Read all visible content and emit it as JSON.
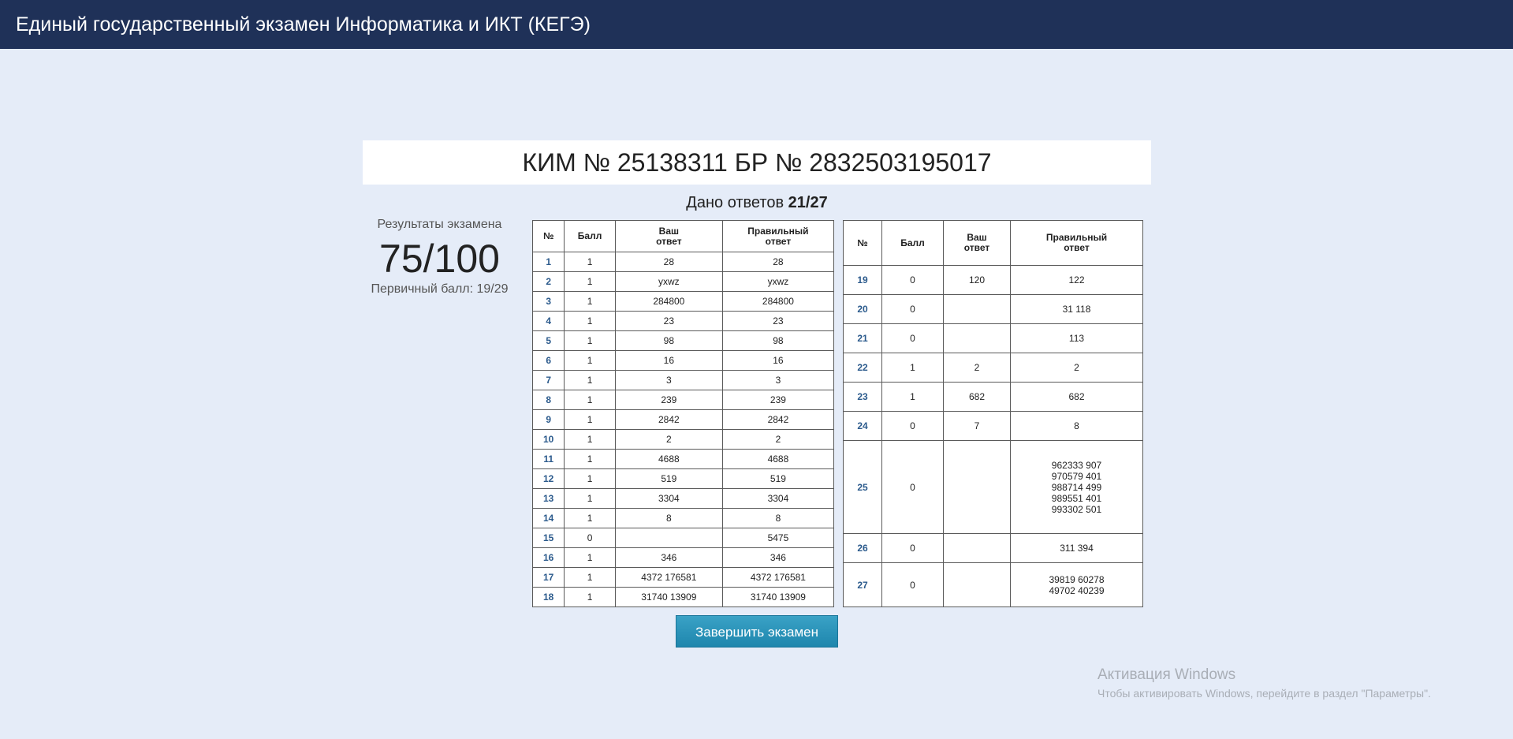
{
  "header": {
    "title": "Единый государственный экзамен Информатика и ИКТ (КЕГЭ)"
  },
  "kim_title": "КИМ № 25138311 БР № 2832503195017",
  "answered": {
    "label": "Дано ответов",
    "value": "21/27"
  },
  "results": {
    "label": "Результаты экзамена",
    "score": "75/100",
    "primary": "Первичный балл: 19/29"
  },
  "table_headers": {
    "num": "№",
    "score": "Балл",
    "your_answer": [
      "Ваш",
      "ответ"
    ],
    "correct_answer": [
      "Правильный",
      "ответ"
    ]
  },
  "left_rows": [
    {
      "num": "1",
      "score": "1",
      "yours": [
        "28"
      ],
      "correct": [
        "28"
      ]
    },
    {
      "num": "2",
      "score": "1",
      "yours": [
        "yxwz"
      ],
      "correct": [
        "yxwz"
      ]
    },
    {
      "num": "3",
      "score": "1",
      "yours": [
        "284800"
      ],
      "correct": [
        "284800"
      ]
    },
    {
      "num": "4",
      "score": "1",
      "yours": [
        "23"
      ],
      "correct": [
        "23"
      ]
    },
    {
      "num": "5",
      "score": "1",
      "yours": [
        "98"
      ],
      "correct": [
        "98"
      ]
    },
    {
      "num": "6",
      "score": "1",
      "yours": [
        "16"
      ],
      "correct": [
        "16"
      ]
    },
    {
      "num": "7",
      "score": "1",
      "yours": [
        "3"
      ],
      "correct": [
        "3"
      ]
    },
    {
      "num": "8",
      "score": "1",
      "yours": [
        "239"
      ],
      "correct": [
        "239"
      ]
    },
    {
      "num": "9",
      "score": "1",
      "yours": [
        "2842"
      ],
      "correct": [
        "2842"
      ]
    },
    {
      "num": "10",
      "score": "1",
      "yours": [
        "2"
      ],
      "correct": [
        "2"
      ]
    },
    {
      "num": "11",
      "score": "1",
      "yours": [
        "4688"
      ],
      "correct": [
        "4688"
      ]
    },
    {
      "num": "12",
      "score": "1",
      "yours": [
        "519"
      ],
      "correct": [
        "519"
      ]
    },
    {
      "num": "13",
      "score": "1",
      "yours": [
        "3304"
      ],
      "correct": [
        "3304"
      ]
    },
    {
      "num": "14",
      "score": "1",
      "yours": [
        "8"
      ],
      "correct": [
        "8"
      ]
    },
    {
      "num": "15",
      "score": "0",
      "yours": [
        ""
      ],
      "correct": [
        "5475"
      ]
    },
    {
      "num": "16",
      "score": "1",
      "yours": [
        "346"
      ],
      "correct": [
        "346"
      ]
    },
    {
      "num": "17",
      "score": "1",
      "yours": [
        "4372 176581"
      ],
      "correct": [
        "4372 176581"
      ]
    },
    {
      "num": "18",
      "score": "1",
      "yours": [
        "31740 13909"
      ],
      "correct": [
        "31740 13909"
      ]
    }
  ],
  "right_rows": [
    {
      "num": "19",
      "score": "0",
      "yours": [
        "120"
      ],
      "correct": [
        "122"
      ]
    },
    {
      "num": "20",
      "score": "0",
      "yours": [
        ""
      ],
      "correct": [
        "31 118"
      ]
    },
    {
      "num": "21",
      "score": "0",
      "yours": [
        ""
      ],
      "correct": [
        "113"
      ]
    },
    {
      "num": "22",
      "score": "1",
      "yours": [
        "2"
      ],
      "correct": [
        "2"
      ]
    },
    {
      "num": "23",
      "score": "1",
      "yours": [
        "682"
      ],
      "correct": [
        "682"
      ]
    },
    {
      "num": "24",
      "score": "0",
      "yours": [
        "7"
      ],
      "correct": [
        "8"
      ]
    },
    {
      "num": "25",
      "score": "0",
      "yours": [
        ""
      ],
      "correct": [
        "962333 907",
        "970579 401",
        "988714 499",
        "989551 401",
        "993302 501"
      ]
    },
    {
      "num": "26",
      "score": "0",
      "yours": [
        ""
      ],
      "correct": [
        "311 394"
      ]
    },
    {
      "num": "27",
      "score": "0",
      "yours": [
        ""
      ],
      "correct": [
        "39819 60278",
        "49702 40239"
      ]
    }
  ],
  "finish_button": "Завершить экзамен",
  "watermark": {
    "title": "Активация Windows",
    "text": "Чтобы активировать Windows, перейдите в раздел \"Параметры\"."
  }
}
